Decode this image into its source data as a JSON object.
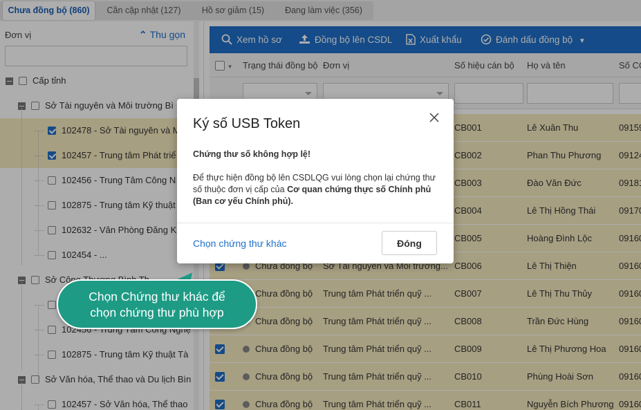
{
  "tabs": [
    {
      "label": "Chưa đồng bộ (860)"
    },
    {
      "label": "Cần cập nhật (127)"
    },
    {
      "label": "Hồ sơ giảm (15)"
    },
    {
      "label": "Đang làm việc (356)"
    }
  ],
  "left_panel": {
    "header": "Đơn vị",
    "collapse_label": "Thu gọn",
    "tree": [
      {
        "label": "Cấp tỉnh",
        "checked": false
      },
      {
        "label": "Sở Tài nguyên và Môi trường Bì",
        "checked": false
      },
      {
        "label": "102478 - Sở Tài nguyên và M",
        "checked": true
      },
      {
        "label": "102457 - Trung tâm Phát triể",
        "checked": true
      },
      {
        "label": "102456 - Trung Tâm Công N",
        "checked": false
      },
      {
        "label": "102875 - Trung tâm Kỹ thuật",
        "checked": false
      },
      {
        "label": "102632 - Văn Phòng Đăng K",
        "checked": false
      },
      {
        "label": "102454 - ...",
        "checked": false
      },
      {
        "label": "Sở Công Thương Bình Th",
        "checked": false
      },
      {
        "label": "",
        "checked": false
      },
      {
        "label": "102456 - Trung Tâm Công Nghệ",
        "checked": false
      },
      {
        "label": "102875 - Trung tâm Kỹ thuật Tà",
        "checked": false
      },
      {
        "label": "Sở Văn hóa, Thể thao và Du lịch Bìn",
        "checked": false
      },
      {
        "label": "102457 - Sở Văn hóa, Thể thao",
        "checked": false
      }
    ]
  },
  "toolbar": {
    "view_label": "Xem hồ sơ",
    "sync_label": "Đồng bộ lên CSDL",
    "export_label": "Xuất khẩu",
    "mark_label": "Đánh dấu đồng bộ"
  },
  "grid": {
    "columns": [
      "Trạng thái đồng bộ",
      "Đơn vị",
      "Số hiệu cán bộ",
      "Họ và tên",
      "Số CC"
    ],
    "rows": [
      {
        "status": "",
        "unit": "",
        "code": "CB001",
        "name": "Lê Xuân Thu",
        "id": "09159"
      },
      {
        "status": "",
        "unit": "",
        "code": "CB002",
        "name": "Phan Thu Phương",
        "id": "09124"
      },
      {
        "status": "",
        "unit": "",
        "code": "CB003",
        "name": "Đào Văn Đức",
        "id": "09181"
      },
      {
        "status": "",
        "unit": "",
        "code": "CB004",
        "name": "Lê Thị Hồng Thái",
        "id": "09170"
      },
      {
        "status": "",
        "unit": "",
        "code": "CB005",
        "name": "Hoàng Đình Lộc",
        "id": "09160"
      },
      {
        "status": "Chưa đồng bộ",
        "unit": "Sở Tài nguyên và Môi trường...",
        "code": "CB006",
        "name": "Lê Thị Thiện",
        "id": "09160"
      },
      {
        "status": "Chưa đồng bộ",
        "unit": "Trung tâm Phát triển quỹ ...",
        "code": "CB007",
        "name": "Lê Thị Thu Thủy",
        "id": "09160"
      },
      {
        "status": "Chưa đồng bộ",
        "unit": "Trung tâm Phát triển quỹ ...",
        "code": "CB008",
        "name": "Trần Đức Hùng",
        "id": "09160"
      },
      {
        "status": "Chưa đồng bộ",
        "unit": "Trung tâm Phát triển quỹ ...",
        "code": "CB009",
        "name": "Lê Thị Phương Hoa",
        "id": "09160"
      },
      {
        "status": "Chưa đồng bộ",
        "unit": "Trung tâm Phát triển quỹ ...",
        "code": "CB010",
        "name": "Phùng Hoài Sơn",
        "id": "09160"
      },
      {
        "status": "Chưa đồng bộ",
        "unit": "Trung tâm Phát triển quỹ ...",
        "code": "CB011",
        "name": "Nguyễn Bích Phương",
        "id": "09160"
      }
    ]
  },
  "modal": {
    "title": "Ký số USB Token",
    "error": "Chứng thư số không hợp lệ!",
    "message_prefix": "Để thực hiện đồng bộ lên CSDLQG vui lòng chọn lại chứng thư số thuộc đơn vị cấp của ",
    "message_bold": "Cơ quan chứng thực số Chính phủ (Ban cơ yếu Chính phủ).",
    "link_label": "Chọn chứng thư khác",
    "close_label": "Đóng"
  },
  "callout": {
    "line1": "Chọn Chứng thư khác để",
    "line2": "chọn chứng thư phù hợp"
  },
  "colors": {
    "accent": "#1e6fc9",
    "selected_row": "#f7ebc0",
    "callout": "#1d9b85"
  }
}
